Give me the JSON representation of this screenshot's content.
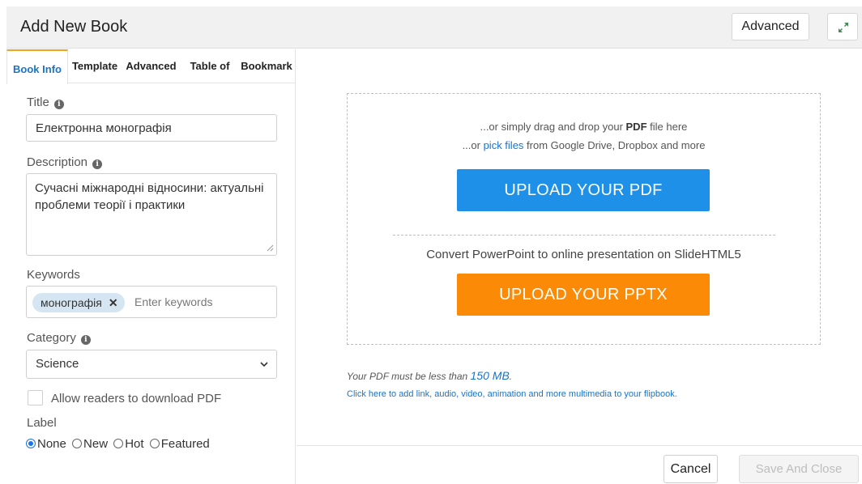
{
  "header": {
    "title": "Add New Book",
    "advanced_label": "Advanced",
    "expand_icon": "expand-icon"
  },
  "tabs": [
    {
      "label": "Book Info",
      "active": true
    },
    {
      "label": "Template",
      "active": false
    },
    {
      "label": "Advanced",
      "active": false
    },
    {
      "label": "Table of",
      "active": false
    },
    {
      "label": "Bookmark",
      "active": false
    }
  ],
  "form": {
    "title_label": "Title",
    "title_value": "Електронна монографія",
    "description_label": "Description",
    "description_value": "Сучасні міжнародні відносини: актуальні проблеми теорії і практики",
    "keywords_label": "Keywords",
    "keyword_chips": [
      "монографія"
    ],
    "keywords_placeholder": "Enter keywords",
    "category_label": "Category",
    "category_value": "Science",
    "allow_download_label": "Allow readers to download PDF",
    "allow_download_checked": false,
    "label_label": "Label",
    "label_options": [
      "None",
      "New",
      "Hot",
      "Featured"
    ],
    "label_selected": "None",
    "info_icon": "info-icon"
  },
  "upload": {
    "drag_prefix": "...or simply drag and drop your ",
    "drag_bold": "PDF",
    "drag_suffix": " file here",
    "pick_prefix": "...or ",
    "pick_link": "pick files",
    "pick_suffix": " from Google Drive, Dropbox and more",
    "pdf_button": "UPLOAD YOUR PDF",
    "convert_text": "Convert PowerPoint to online presentation on SlideHTML5",
    "pptx_button": "UPLOAD YOUR PPTX",
    "size_note_prefix": "Your PDF must be less than ",
    "size_limit": "150 MB",
    "size_note_suffix": ".",
    "multimedia_link": "Click here to add link, audio, video, animation and more multimedia to your flipbook."
  },
  "footer": {
    "cancel_label": "Cancel",
    "save_label": "Save And Close"
  },
  "colors": {
    "pdf_button": "#1e90e8",
    "pptx_button": "#fb8a07",
    "active_tab_text": "#1a73c8",
    "active_tab_accent": "#f0a31c",
    "link": "#1a73c8"
  }
}
